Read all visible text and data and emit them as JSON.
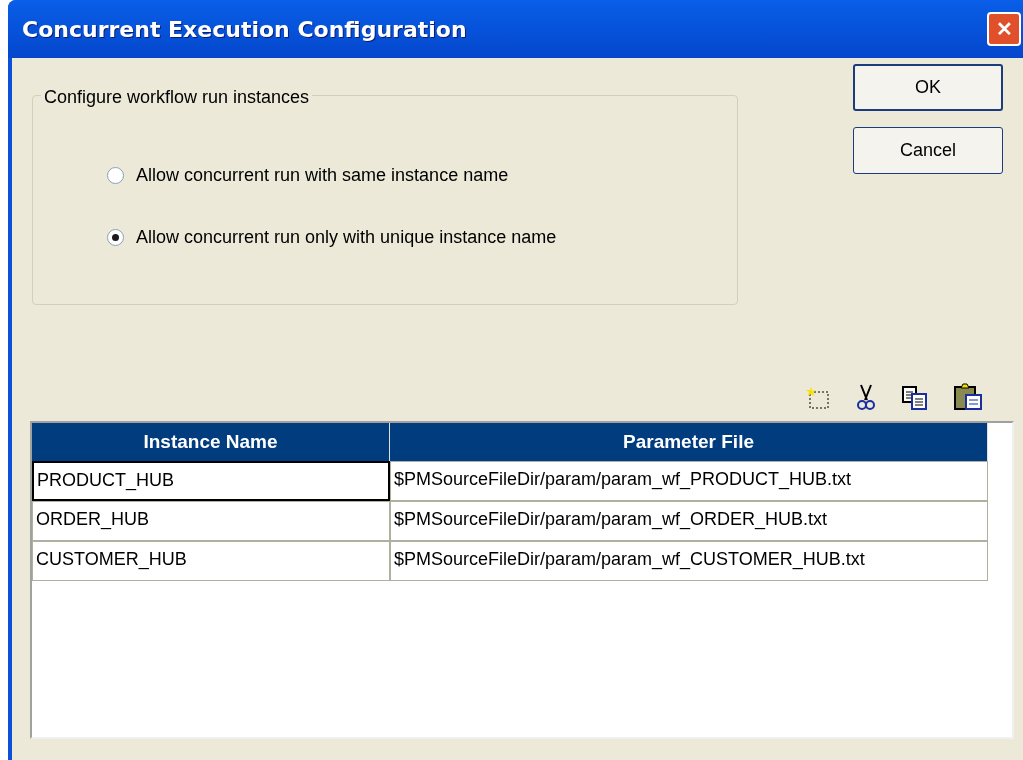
{
  "window": {
    "title": "Concurrent Execution Configuration",
    "close": "✕"
  },
  "group": {
    "title": "Configure workflow run instances",
    "options": [
      {
        "label": "Allow concurrent run with same instance name",
        "selected": false
      },
      {
        "label": "Allow concurrent run only with unique instance name",
        "selected": true
      }
    ]
  },
  "buttons": [
    "OK",
    "Cancel"
  ],
  "table": {
    "columns": [
      "Instance Name",
      "Parameter File"
    ],
    "rows": [
      {
        "cells": [
          "PRODUCT_HUB",
          "$PMSourceFileDir/param/param_wf_PRODUCT_HUB.txt"
        ],
        "selected": true
      },
      {
        "cells": [
          "ORDER_HUB",
          "$PMSourceFileDir/param/param_wf_ORDER_HUB.txt"
        ],
        "selected": false
      },
      {
        "cells": [
          "CUSTOMER_HUB",
          "$PMSourceFileDir/param/param_wf_CUSTOMER_HUB.txt"
        ],
        "selected": false
      }
    ]
  }
}
